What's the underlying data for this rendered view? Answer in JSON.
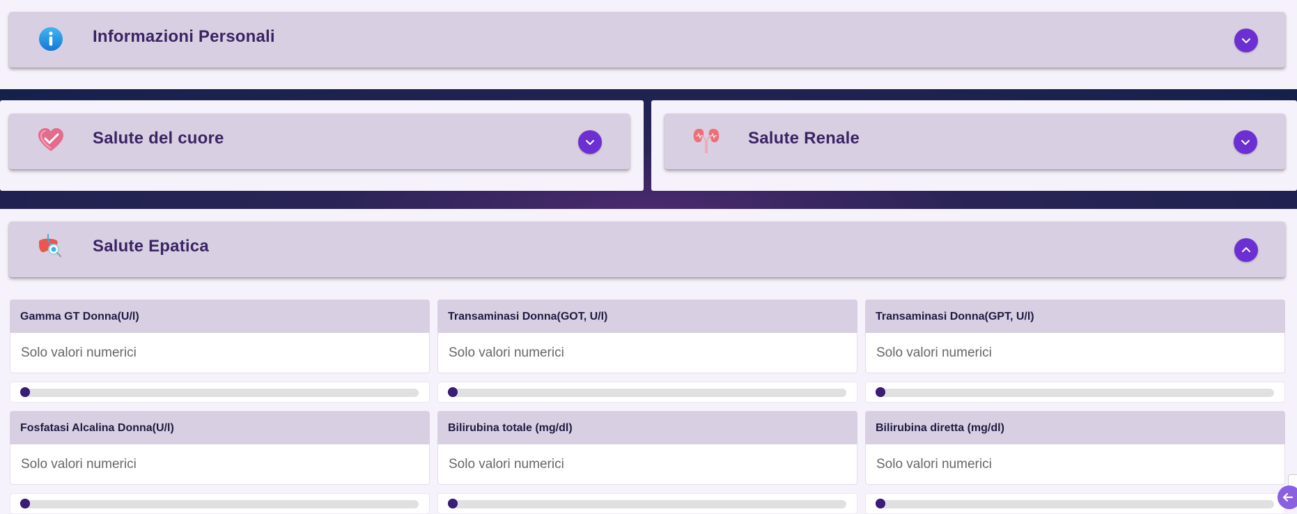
{
  "sections": {
    "personal": {
      "title": "Informazioni Personali",
      "icon": "info-icon",
      "expanded": false
    },
    "heart": {
      "title": "Salute del cuore",
      "icon": "heart-icon",
      "expanded": false
    },
    "kidney": {
      "title": "Salute Renale",
      "icon": "kidney-icon",
      "expanded": false
    },
    "liver": {
      "title": "Salute Epatica",
      "icon": "liver-icon",
      "expanded": true
    }
  },
  "liver_fields": [
    {
      "label": "Gamma GT Donna(U/l)",
      "placeholder": "Solo valori numerici",
      "slider_value": 0
    },
    {
      "label": "Transaminasi Donna(GOT, U/l)",
      "placeholder": "Solo valori numerici",
      "slider_value": 0
    },
    {
      "label": "Transaminasi Donna(GPT, U/l)",
      "placeholder": "Solo valori numerici",
      "slider_value": 0
    },
    {
      "label": "Fosfatasi Alcalina Donna(U/l)",
      "placeholder": "Solo valori numerici",
      "slider_value": 0
    },
    {
      "label": "Bilirubina totale (mg/dl)",
      "placeholder": "Solo valori numerici",
      "slider_value": 0
    },
    {
      "label": "Bilirubina diretta (mg/dl)",
      "placeholder": "Solo valori numerici",
      "slider_value": 0
    }
  ],
  "colors": {
    "accent": "#6c2fd1",
    "panel_header_bg": "#d8d0e2",
    "page_bg": "#f6f2fb",
    "band_dark": "#15214a",
    "title_text": "#3b2364",
    "slider_thumb": "#3a1d7a"
  },
  "scroll_button_icon": "arrow-left-icon"
}
